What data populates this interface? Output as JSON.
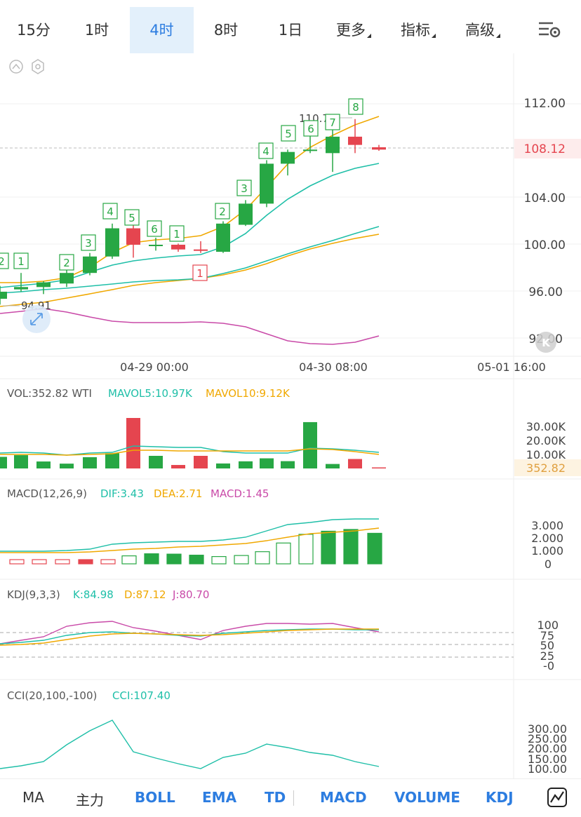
{
  "tabs": [
    {
      "label": "15分",
      "caret": false
    },
    {
      "label": "1时",
      "caret": false
    },
    {
      "label": "4时",
      "caret": false,
      "active": true
    },
    {
      "label": "8时",
      "caret": false
    },
    {
      "label": "1日",
      "caret": false
    },
    {
      "label": "更多",
      "caret": true
    },
    {
      "label": "指标",
      "caret": true
    },
    {
      "label": "高级",
      "caret": true
    }
  ],
  "price_axis": [
    "112.00",
    "108.12",
    "104.00",
    "100.00",
    "96.00",
    "92.00"
  ],
  "current_price": "108.12",
  "high_label": "110.72",
  "low_label": "94.91",
  "time_axis": [
    "04-29 00:00",
    "04-30 08:00",
    "05-01 16:00"
  ],
  "td_up": [
    "2",
    "1",
    "2",
    "3",
    "4",
    "5",
    "6",
    "1",
    "2",
    "3",
    "4",
    "5",
    "6",
    "7",
    "8"
  ],
  "td_down": [
    "1"
  ],
  "vol": {
    "label": "VOL:352.82 WTI",
    "mavol5": "MAVOL5:10.97K",
    "mavol10": "MAVOL10:9.12K",
    "axis": [
      "30.00K",
      "20.00K",
      "10.00K"
    ],
    "current": "352.82"
  },
  "macd": {
    "label": "MACD(12,26,9)",
    "dif": "DIF:3.43",
    "dea": "DEA:2.71",
    "macd": "MACD:1.45",
    "axis": [
      "3.000",
      "2.000",
      "1.000",
      "0"
    ]
  },
  "kdj": {
    "label": "KDJ(9,3,3)",
    "k": "K:84.98",
    "d": "D:87.12",
    "j": "J:80.70",
    "axis": [
      "100",
      "75",
      "50",
      "25",
      "-0"
    ]
  },
  "cci": {
    "label": "CCI(20,100,-100)",
    "value": "CCI:107.40",
    "axis": [
      "300.00",
      "250.00",
      "200.00",
      "150.00",
      "100.00"
    ]
  },
  "bottom": [
    {
      "label": "MA",
      "blue": false
    },
    {
      "label": "主力",
      "blue": false
    },
    {
      "label": "BOLL",
      "blue": true
    },
    {
      "label": "EMA",
      "blue": true
    },
    {
      "label": "TD",
      "blue": true
    },
    {
      "label": "MACD",
      "blue": true
    },
    {
      "label": "VOLUME",
      "blue": true
    },
    {
      "label": "KDJ",
      "blue": true
    }
  ],
  "colors": {
    "up": "#27a744",
    "down": "#e5454f",
    "ma_yellow": "#f0a800",
    "ma_teal": "#1fbfa8",
    "boll_pink": "#c94aa8",
    "accent": "#2d7de0"
  },
  "chart_data": [
    {
      "type": "candlestick",
      "title": "",
      "ylim": [
        90,
        114
      ],
      "candles": [
        {
          "o": 95.4,
          "h": 96.5,
          "l": 94.9,
          "c": 96.0
        },
        {
          "o": 96.2,
          "h": 97.6,
          "l": 96.0,
          "c": 96.4
        },
        {
          "o": 96.4,
          "h": 96.9,
          "l": 95.8,
          "c": 96.8
        },
        {
          "o": 96.7,
          "h": 98.0,
          "l": 96.4,
          "c": 97.6
        },
        {
          "o": 97.6,
          "h": 99.3,
          "l": 97.4,
          "c": 99.0
        },
        {
          "o": 99.0,
          "h": 101.8,
          "l": 98.8,
          "c": 101.4
        },
        {
          "o": 101.4,
          "h": 101.8,
          "l": 98.9,
          "c": 100.0
        },
        {
          "o": 99.9,
          "h": 100.6,
          "l": 99.5,
          "c": 100.0
        },
        {
          "o": 100.0,
          "h": 100.1,
          "l": 99.4,
          "c": 99.6
        },
        {
          "o": 99.6,
          "h": 100.3,
          "l": 99.3,
          "c": 99.5
        },
        {
          "o": 99.4,
          "h": 102.0,
          "l": 99.3,
          "c": 101.8
        },
        {
          "o": 101.7,
          "h": 103.8,
          "l": 101.6,
          "c": 103.5
        },
        {
          "o": 103.5,
          "h": 107.2,
          "l": 103.2,
          "c": 106.9
        },
        {
          "o": 106.9,
          "h": 108.1,
          "l": 105.9,
          "c": 107.9
        },
        {
          "o": 108.0,
          "h": 109.3,
          "l": 107.8,
          "c": 108.1
        },
        {
          "o": 107.8,
          "h": 110.0,
          "l": 106.2,
          "c": 109.2
        },
        {
          "o": 109.2,
          "h": 110.7,
          "l": 107.8,
          "c": 108.5
        },
        {
          "o": 108.3,
          "h": 108.5,
          "l": 108.0,
          "c": 108.1
        }
      ]
    },
    {
      "type": "bar",
      "title": "VOL",
      "values": [
        7000,
        8000,
        4200,
        2900,
        6800,
        9200,
        30400,
        7600,
        2100,
        7600,
        3000,
        4300,
        6100,
        4400,
        27900,
        2700,
        5700,
        352
      ]
    },
    {
      "type": "line",
      "title": "MACD",
      "series": [
        {
          "name": "DIF",
          "values": [
            0.72,
            0.72,
            0.72,
            0.75,
            0.82,
            1.15,
            1.27,
            1.33,
            1.37,
            1.38,
            1.48,
            1.68,
            2.12,
            2.62,
            2.97,
            3.26,
            3.41,
            3.43
          ]
        },
        {
          "name": "DEA",
          "values": [
            0.88,
            0.86,
            0.85,
            0.84,
            0.86,
            0.92,
            0.98,
            1.05,
            1.12,
            1.17,
            1.24,
            1.33,
            1.52,
            1.77,
            2.03,
            2.27,
            2.53,
            2.71
          ]
        }
      ]
    },
    {
      "type": "line",
      "title": "KDJ",
      "series": [
        {
          "name": "K",
          "values": [
            55,
            60,
            66,
            75,
            80,
            81,
            78,
            75,
            72,
            70,
            76,
            80,
            83,
            85,
            86,
            86,
            85,
            85
          ]
        },
        {
          "name": "D",
          "values": [
            52,
            55,
            58,
            65,
            72,
            76,
            77,
            75,
            74,
            73,
            74,
            77,
            80,
            83,
            85,
            86,
            87,
            87
          ]
        },
        {
          "name": "J",
          "values": [
            55,
            63,
            70,
            95,
            102,
            104,
            90,
            82,
            72,
            60,
            78,
            92,
            99,
            99,
            97,
            98,
            85,
            81
          ]
        }
      ]
    },
    {
      "type": "line",
      "title": "CCI",
      "series": [
        {
          "name": "CCI",
          "values": [
            75,
            105,
            140,
            245,
            330,
            190,
            155,
            120,
            100,
            155,
            180,
            230,
            210,
            190,
            180,
            135,
            107
          ]
        }
      ]
    }
  ]
}
